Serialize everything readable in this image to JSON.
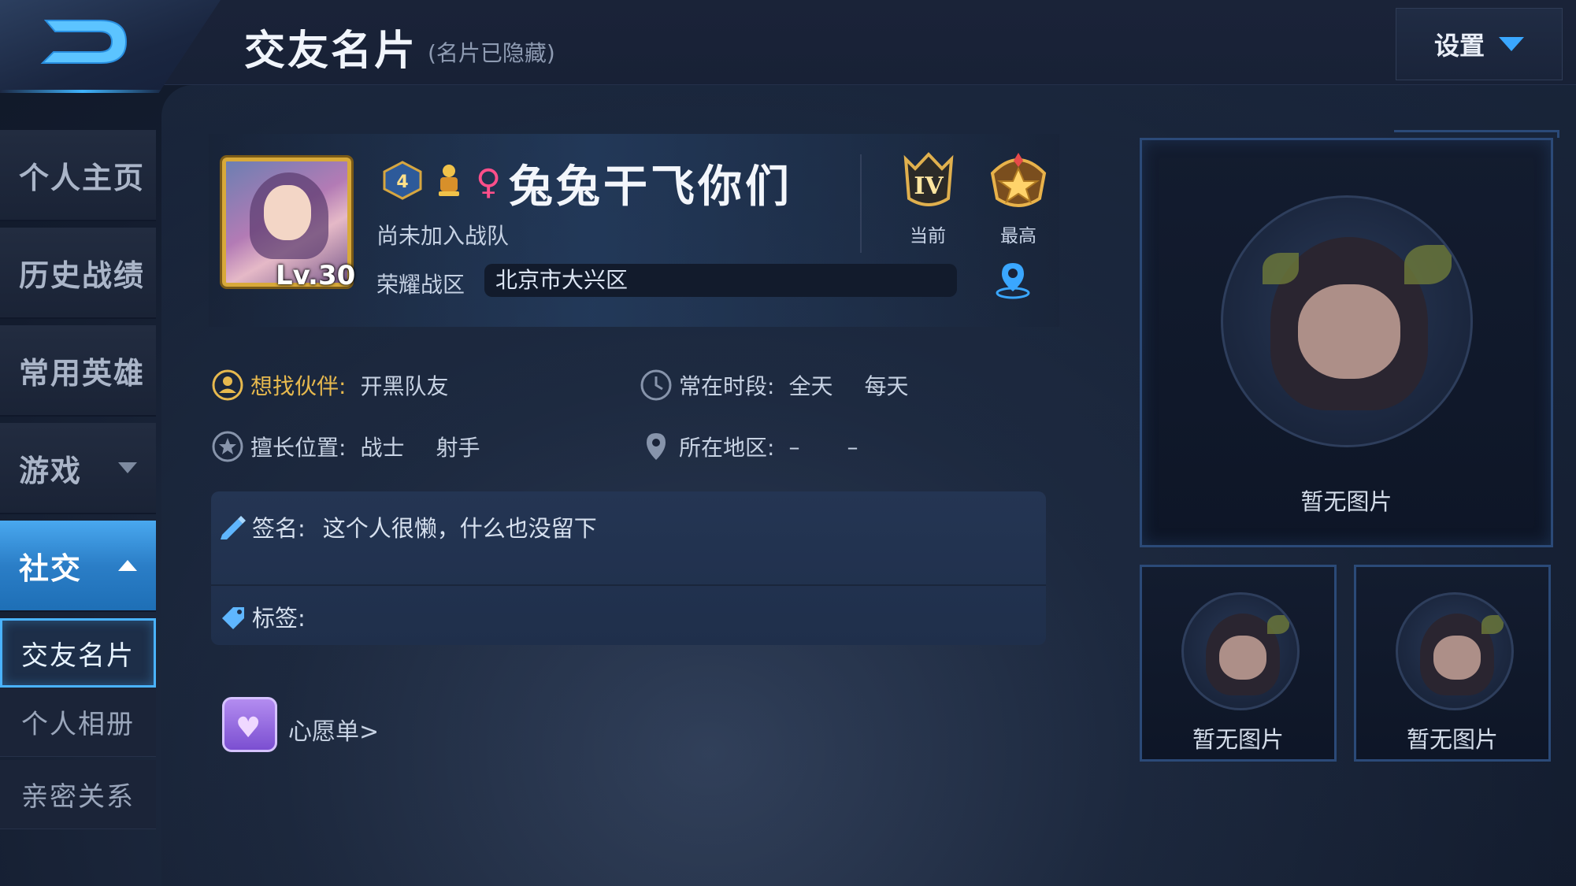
{
  "header": {
    "title": "交友名片",
    "subtitle": "(名片已隐藏)",
    "settings_label": "设置"
  },
  "sidebar": {
    "items": [
      {
        "label": "个人主页"
      },
      {
        "label": "历史战绩"
      },
      {
        "label": "常用英雄"
      },
      {
        "label": "游戏"
      },
      {
        "label": "社交"
      }
    ],
    "sub_items": [
      {
        "label": "交友名片"
      },
      {
        "label": "个人相册"
      },
      {
        "label": "亲密关系"
      }
    ]
  },
  "profile": {
    "level": "Lv.30",
    "badge_number": "4",
    "name": "兔兔干飞你们",
    "team_status": "尚未加入战队",
    "zone_label": "荣耀战区",
    "zone_value": "北京市大兴区",
    "rank_current_label": "当前",
    "rank_highest_label": "最高",
    "rank_current_symbol": "IV"
  },
  "info": {
    "partner_label": "想找伙伴:",
    "partner_value": "开黑队友",
    "time_label": "常在时段:",
    "time_value_1": "全天",
    "time_value_2": "每天",
    "position_label": "擅长位置:",
    "position_value_1": "战士",
    "position_value_2": "射手",
    "region_label": "所在地区:",
    "region_value_1": "–",
    "region_value_2": "–"
  },
  "signature": {
    "label": "签名:",
    "value": "这个人很懒，什么也没留下",
    "tags_label": "标签:"
  },
  "wishlist": {
    "label": "心愿单>"
  },
  "gallery": {
    "main_caption": "暂无图片",
    "small_captions": [
      "暂无图片",
      "暂无图片"
    ]
  },
  "colors": {
    "accent_blue": "#3aa7ff",
    "gold_label": "#e7b94e",
    "female_pink": "#ff4f8a"
  }
}
